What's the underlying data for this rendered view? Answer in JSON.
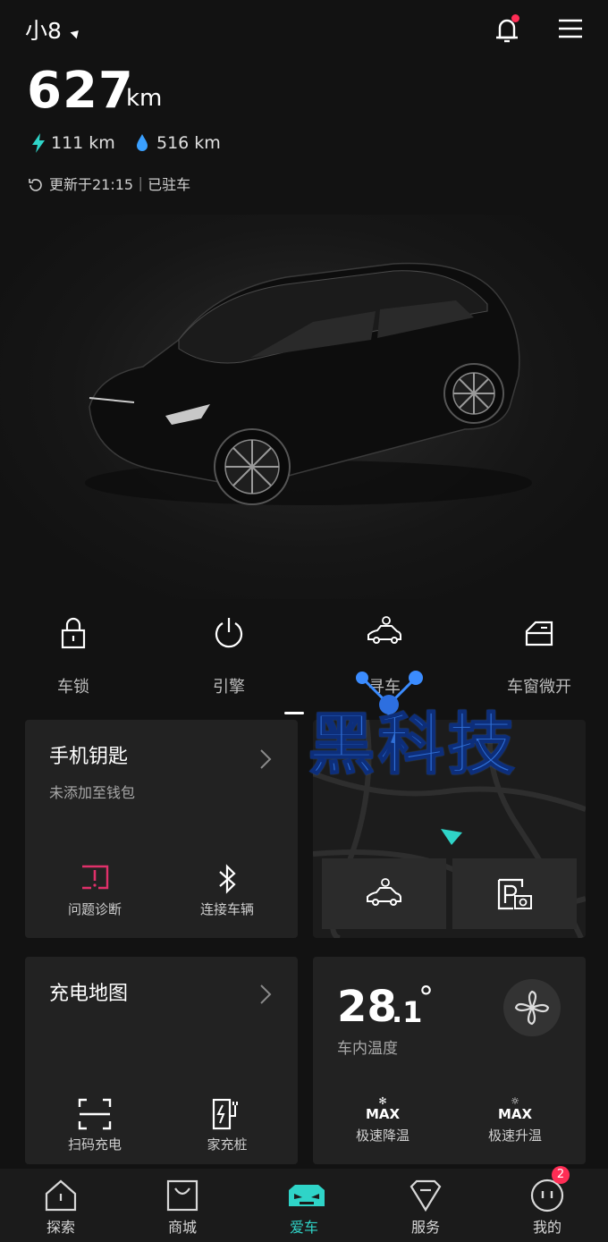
{
  "header": {
    "vehicle_name": "小8",
    "range_value": "627",
    "range_unit": "km",
    "electric_range": "111 km",
    "fuel_range": "516 km",
    "update_status": "更新于21:15｜已驻车"
  },
  "quick_controls": [
    {
      "label": "车锁",
      "icon": "lock-icon"
    },
    {
      "label": "引擎",
      "icon": "power-icon"
    },
    {
      "label": "寻车",
      "icon": "find-car-icon"
    },
    {
      "label": "车窗微开",
      "icon": "window-icon"
    }
  ],
  "phone_key_card": {
    "title": "手机钥匙",
    "subtitle": "未添加至钱包",
    "actions": [
      {
        "label": "问题诊断",
        "icon": "diagnosis-icon"
      },
      {
        "label": "连接车辆",
        "icon": "bluetooth-icon"
      }
    ]
  },
  "charging_card": {
    "title": "充电地图",
    "actions": [
      {
        "label": "扫码充电",
        "icon": "scan-icon"
      },
      {
        "label": "家充桩",
        "icon": "home-charger-icon"
      }
    ]
  },
  "climate_card": {
    "temp_int": "28",
    "temp_dec": ".1",
    "temp_deg": "°",
    "label": "车内温度",
    "actions": [
      {
        "label": "极速降温",
        "badge": "MAX"
      },
      {
        "label": "极速升温",
        "badge": "MAX"
      }
    ]
  },
  "watermark": {
    "text": "黑科技"
  },
  "tabs": [
    {
      "label": "探索"
    },
    {
      "label": "商城"
    },
    {
      "label": "爱车"
    },
    {
      "label": "服务"
    },
    {
      "label": "我的"
    }
  ],
  "badge_count": "2",
  "colors": {
    "accent": "#2fd4c8",
    "notification": "#ff2d55",
    "diagnosis": "#e0306a",
    "background": "#121212",
    "card": "#222222"
  }
}
